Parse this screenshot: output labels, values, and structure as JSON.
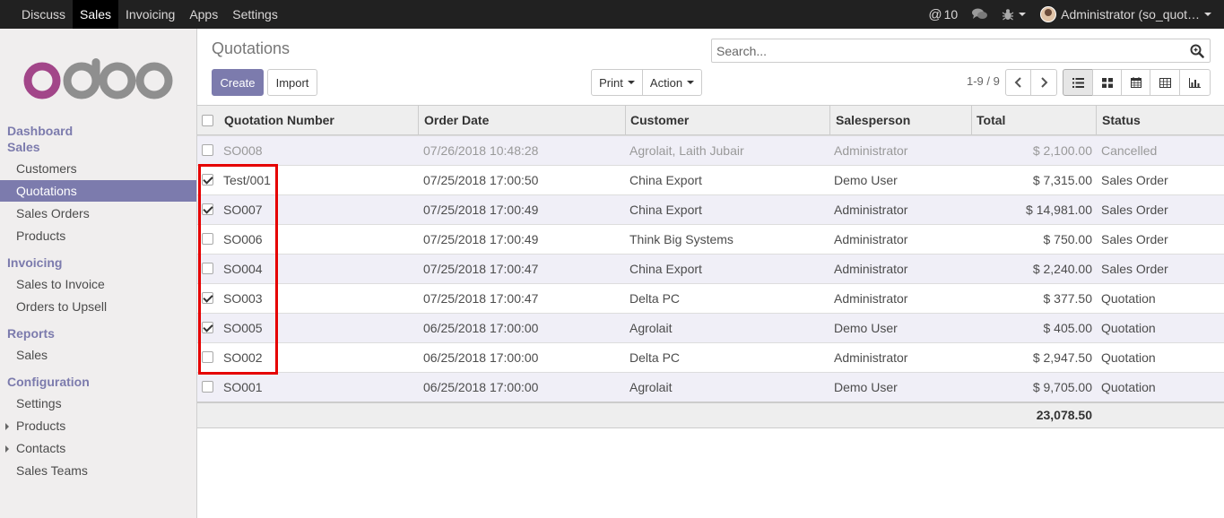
{
  "topbar": {
    "menu": [
      "Discuss",
      "Sales",
      "Invoicing",
      "Apps",
      "Settings"
    ],
    "active_menu": "Sales",
    "mentions": "10",
    "user": "Administrator (so_quot…"
  },
  "sidebar": {
    "dashboard": "Dashboard",
    "sales_head": "Sales",
    "customers": "Customers",
    "quotations": "Quotations",
    "sales_orders": "Sales Orders",
    "products": "Products",
    "invoicing_head": "Invoicing",
    "sales_to_invoice": "Sales to Invoice",
    "orders_to_upsell": "Orders to Upsell",
    "reports_head": "Reports",
    "reports_sales": "Sales",
    "configuration_head": "Configuration",
    "settings": "Settings",
    "config_products": "Products",
    "contacts": "Contacts",
    "sales_teams": "Sales Teams"
  },
  "control": {
    "title": "Quotations",
    "search_placeholder": "Search...",
    "create": "Create",
    "import": "Import",
    "print": "Print",
    "action": "Action",
    "pager": "1-9 / 9"
  },
  "table": {
    "headers": {
      "number": "Quotation Number",
      "date": "Order Date",
      "customer": "Customer",
      "salesperson": "Salesperson",
      "total": "Total",
      "status": "Status"
    },
    "rows": [
      {
        "checked": false,
        "number": "SO008",
        "date": "07/26/2018 10:48:28",
        "customer": "Agrolait, Laith Jubair",
        "salesperson": "Administrator",
        "total": "$ 2,100.00",
        "status": "Cancelled"
      },
      {
        "checked": true,
        "number": "Test/001",
        "date": "07/25/2018 17:00:50",
        "customer": "China Export",
        "salesperson": "Demo User",
        "total": "$ 7,315.00",
        "status": "Sales Order"
      },
      {
        "checked": true,
        "number": "SO007",
        "date": "07/25/2018 17:00:49",
        "customer": "China Export",
        "salesperson": "Administrator",
        "total": "$ 14,981.00",
        "status": "Sales Order"
      },
      {
        "checked": false,
        "number": "SO006",
        "date": "07/25/2018 17:00:49",
        "customer": "Think Big Systems",
        "salesperson": "Administrator",
        "total": "$ 750.00",
        "status": "Sales Order"
      },
      {
        "checked": false,
        "number": "SO004",
        "date": "07/25/2018 17:00:47",
        "customer": "China Export",
        "salesperson": "Administrator",
        "total": "$ 2,240.00",
        "status": "Sales Order"
      },
      {
        "checked": true,
        "number": "SO003",
        "date": "07/25/2018 17:00:47",
        "customer": "Delta PC",
        "salesperson": "Administrator",
        "total": "$ 377.50",
        "status": "Quotation"
      },
      {
        "checked": true,
        "number": "SO005",
        "date": "06/25/2018 17:00:00",
        "customer": "Agrolait",
        "salesperson": "Demo User",
        "total": "$ 405.00",
        "status": "Quotation"
      },
      {
        "checked": false,
        "number": "SO002",
        "date": "06/25/2018 17:00:00",
        "customer": "Delta PC",
        "salesperson": "Administrator",
        "total": "$ 2,947.50",
        "status": "Quotation"
      },
      {
        "checked": false,
        "number": "SO001",
        "date": "06/25/2018 17:00:00",
        "customer": "Agrolait",
        "salesperson": "Demo User",
        "total": "$ 9,705.00",
        "status": "Quotation"
      }
    ],
    "sum_total": "23,078.50"
  },
  "colors": {
    "accent": "#7c7bad",
    "topbar": "#212121",
    "highlight_box": "#e50000",
    "logo_purple": "#a24689",
    "logo_gray": "#8f8f8f"
  }
}
